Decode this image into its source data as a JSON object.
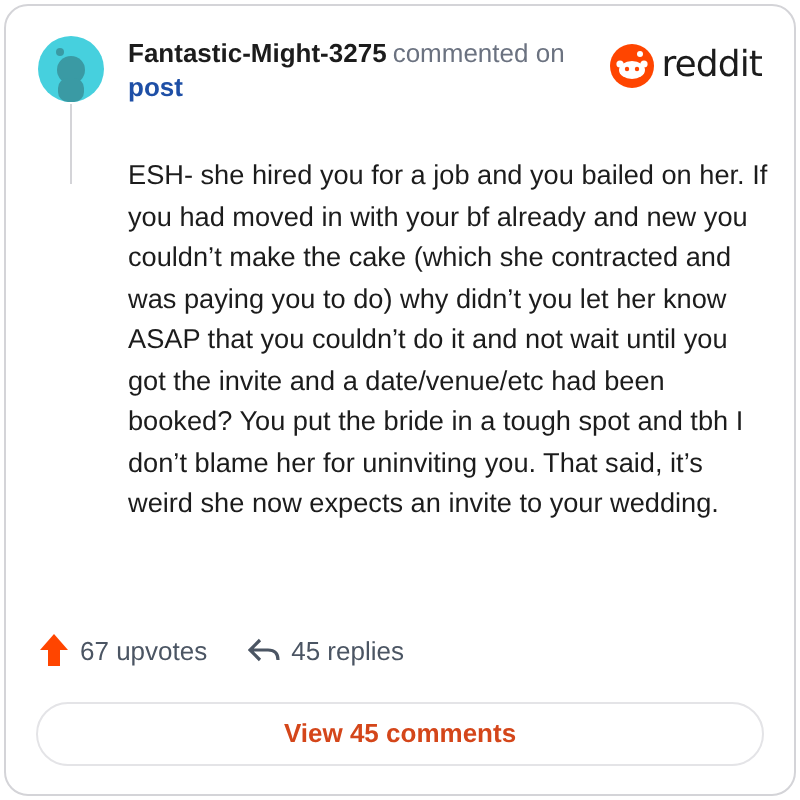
{
  "comment": {
    "author": "Fantastic-Might-3275",
    "action": "commented on",
    "link": "post",
    "brand": "reddit",
    "body": "ESH- she hired you for a job and you bailed on her. If you had moved in with your bf already and new you couldn’t make the cake (which she contracted and was paying you to do) why didn’t you let her know ASAP that you couldn’t do it and not wait until you got the invite and a date/venue/etc had been booked? You put the bride in a tough spot and tbh I don’t blame her for uninviting you. That said, it’s weird she now expects an invite to your wedding.",
    "upvotes": "67 upvotes",
    "replies": "45 replies"
  },
  "button": "View 45 comments"
}
